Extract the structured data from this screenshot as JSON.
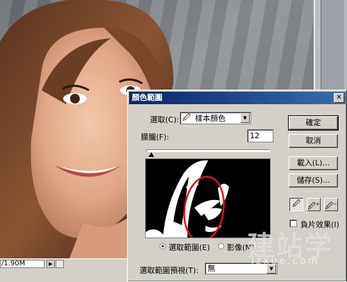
{
  "statusbar": {
    "doc_size": "/1.90M",
    "arrow_glyph": "▶"
  },
  "dialog": {
    "title": "顏色範圍",
    "close_glyph": "✕",
    "select_label": "選取(C):",
    "select_value": "樣本顏色",
    "select_icon": "eyedropper-icon",
    "fuzziness_label": "朦朧(F):",
    "fuzziness_value": "12",
    "radio_selection": "選取範圍(E)",
    "radio_image": "影像(M)",
    "preview_label": "選取範圍預視(T):",
    "preview_value": "無",
    "dropdown_glyph": "▼",
    "buttons": {
      "ok": "確定",
      "cancel": "取消",
      "load": "載入(L)...",
      "save": "儲存(S)..."
    },
    "tools": [
      "eyedropper-icon",
      "eyedropper-plus-icon",
      "eyedropper-minus-icon"
    ],
    "invert_label": "負片效果(I)"
  },
  "watermark": {
    "text": "建站学",
    "url": "jzxue.com"
  },
  "colors": {
    "title_bar_start": "#0a246a",
    "title_bar_end": "#3a6ea5",
    "dialog_face": "#d4d0c8",
    "highlight_ellipse": "#e0101a"
  }
}
